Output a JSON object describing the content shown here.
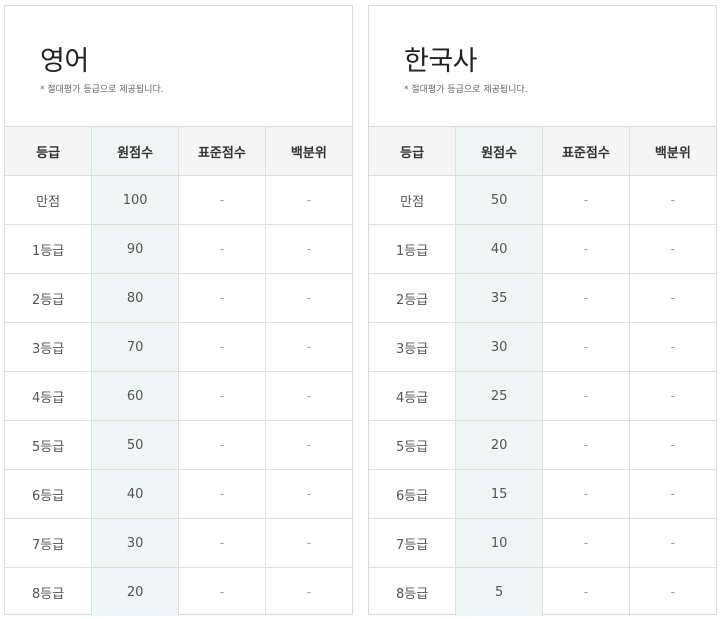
{
  "panels": [
    {
      "title": "영어",
      "note": "* 절대평가 등급으로 제공됩니다.",
      "headers": [
        "등급",
        "원점수",
        "표준점수",
        "백분위"
      ],
      "rows": [
        [
          "만점",
          "100",
          "-",
          "-"
        ],
        [
          "1등급",
          "90",
          "-",
          "-"
        ],
        [
          "2등급",
          "80",
          "-",
          "-"
        ],
        [
          "3등급",
          "70",
          "-",
          "-"
        ],
        [
          "4등급",
          "60",
          "-",
          "-"
        ],
        [
          "5등급",
          "50",
          "-",
          "-"
        ],
        [
          "6등급",
          "40",
          "-",
          "-"
        ],
        [
          "7등급",
          "30",
          "-",
          "-"
        ],
        [
          "8등급",
          "20",
          "-",
          "-"
        ]
      ]
    },
    {
      "title": "한국사",
      "note": "* 절대평가 등급으로 제공됩니다.",
      "headers": [
        "등급",
        "원점수",
        "표준점수",
        "백분위"
      ],
      "rows": [
        [
          "만점",
          "50",
          "-",
          "-"
        ],
        [
          "1등급",
          "40",
          "-",
          "-"
        ],
        [
          "2등급",
          "35",
          "-",
          "-"
        ],
        [
          "3등급",
          "30",
          "-",
          "-"
        ],
        [
          "4등급",
          "25",
          "-",
          "-"
        ],
        [
          "5등급",
          "20",
          "-",
          "-"
        ],
        [
          "6등급",
          "15",
          "-",
          "-"
        ],
        [
          "7등급",
          "10",
          "-",
          "-"
        ],
        [
          "8등급",
          "5",
          "-",
          "-"
        ]
      ]
    }
  ],
  "colors": {
    "raw_score_column": "#eef6f6",
    "header_background": "#f5f5f5",
    "border": "#dedede"
  }
}
